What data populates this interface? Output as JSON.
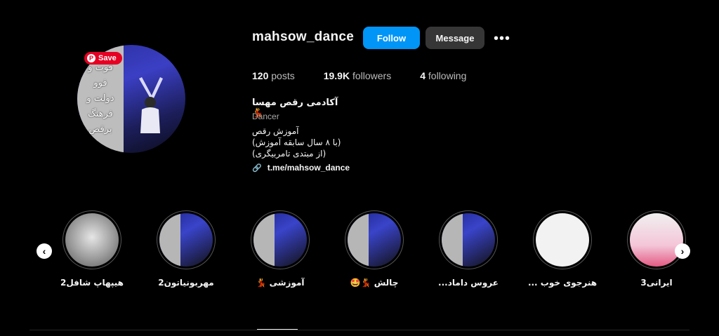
{
  "profile": {
    "username": "mahsow_dance",
    "follow_label": "Follow",
    "message_label": "Message",
    "more_label": "•••",
    "save_label": "Save",
    "avatar_text": [
      "فوت و",
      "فوو",
      "دولت و",
      "فرهنگ",
      "برقص"
    ]
  },
  "stats": {
    "posts_count": "120",
    "posts_label": "posts",
    "followers_count": "19.9K",
    "followers_label": "followers",
    "following_count": "4",
    "following_label": "following"
  },
  "bio": {
    "name": "آکادمی رقص مهسا 💃",
    "category": "Dancer",
    "line1": "آموزش رقص",
    "line2": "(با ۸ سال سابقه آموزش)",
    "line3": "(از مبتدی تامربیگری)",
    "link": "t.me/mahsow_dance",
    "link_icon": "🔗"
  },
  "highlights": [
    {
      "label": "هیپهاپ شافل2",
      "image": "grey"
    },
    {
      "label": "مهربونیاتون2",
      "image": "blue"
    },
    {
      "label": "آموزشی 💃",
      "image": "blue"
    },
    {
      "label": "چالش 💃🤩",
      "image": "blue"
    },
    {
      "label": "عروس داماد...",
      "image": "blue"
    },
    {
      "label": "هنرجوی خوب ...",
      "image": "white"
    },
    {
      "label": "ایرانی3",
      "image": "pink"
    }
  ],
  "nav": {
    "prev_arrow": "‹",
    "next_arrow": "›"
  }
}
